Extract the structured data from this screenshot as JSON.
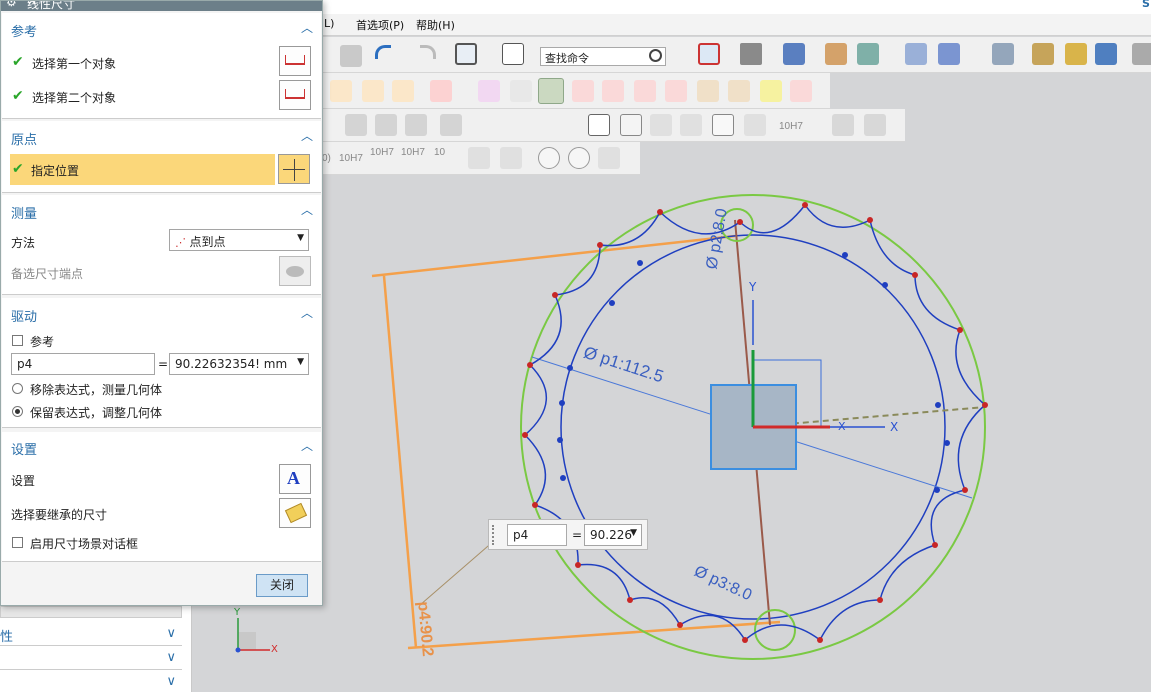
{
  "dialog": {
    "title": "线性尺寸",
    "sections": {
      "reference": {
        "title": "参考",
        "first_object": "选择第一个对象",
        "second_object": "选择第二个对象"
      },
      "origin": {
        "title": "原点",
        "specify_location": "指定位置"
      },
      "measure": {
        "title": "测量",
        "method_label": "方法",
        "method_value": "点到点",
        "alt_endpoint_label": "备选尺寸端点"
      },
      "driving": {
        "title": "驱动",
        "reference_checkbox": "参考",
        "expr_name": "p4",
        "equals": "=",
        "expr_value": "90.22632354! mm",
        "option_remove": "移除表达式，测量几何体",
        "option_keep": "保留表达式，调整几何体"
      },
      "settings": {
        "title": "设置",
        "settings_label": "设置",
        "inherit_label": "选择要继承的尺寸",
        "enable_scene_dialog": "启用尺寸场景对话框"
      }
    },
    "close_button": "关闭"
  },
  "menubar": {
    "item_l": "L)",
    "preferences": "首选项(P)",
    "help": "帮助(H)",
    "right_char": "S"
  },
  "toolbar": {
    "find_command": "查找命令",
    "tol_labels": [
      "0)",
      "10H7",
      "10H7",
      "10H7",
      "10",
      "10H7"
    ]
  },
  "floating_input": {
    "name": "p4",
    "equals": "=",
    "value": "90.226"
  },
  "canvas": {
    "dim_p1": "Ø p1:112.5",
    "dim_p3": "Ø p3:8.0",
    "dim_p2": "Ø p2:8.0",
    "dim_p4": "p4:90.2",
    "axis_x": "X",
    "axis_x2": "X",
    "axis_y": "Y",
    "triad_x": "X",
    "triad_y": "Y"
  },
  "leftnav": {
    "item1": "性",
    "item2": "",
    "item3": ""
  }
}
